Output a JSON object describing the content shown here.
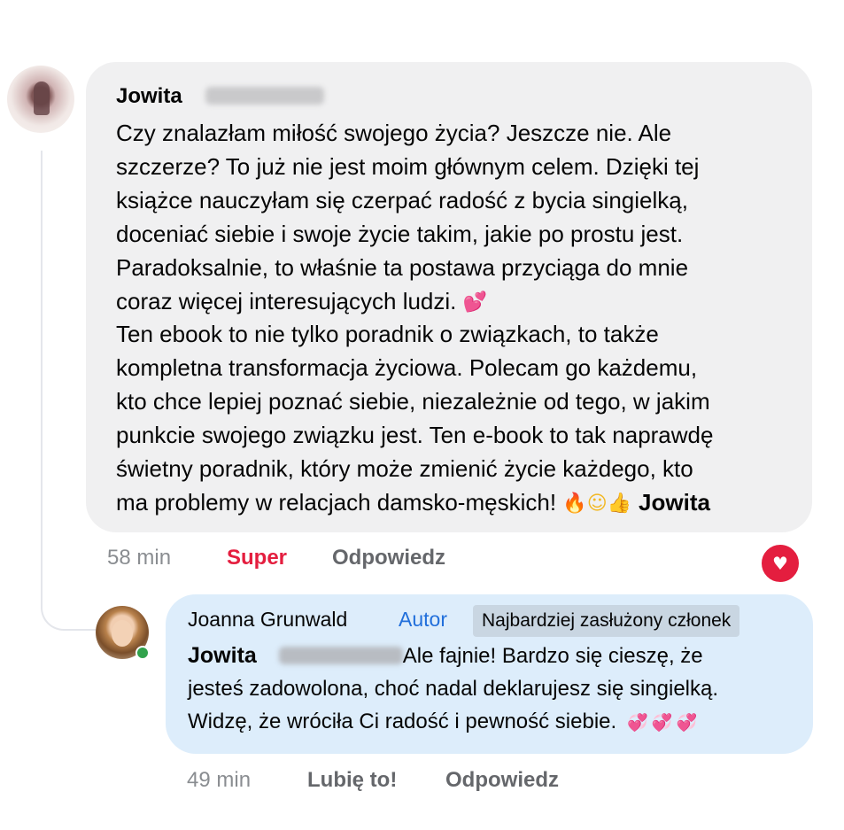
{
  "comment": {
    "author_first_name": "Jowita",
    "avatar_icon": "profile-photo-avatar",
    "lines": [
      "Czy znalazłam miłość swojego życia? Jeszcze nie. Ale",
      "szczerze? To już nie jest moim głównym celem. Dzięki tej",
      "książce nauczyłam się czerpać radość z bycia singielką,",
      "doceniać siebie i swoje życie takim, jakie po prostu jest.",
      "Paradoksalnie, to właśnie ta postawa przyciąga do mnie",
      "coraz więcej interesujących ludzi.",
      "Ten ebook to nie tylko poradnik o związkach, to także",
      "kompletna transformacja życiowa. Polecam go każdemu,",
      "kto chce lepiej poznać siebie, niezależnie od tego, w jakim",
      "punkcie swojego związku jest. Ten e-book to tak naprawdę",
      "świetny poradnik, który może zmienić życie każdego, kto",
      "ma problemy w relacjach damsko-męskich!"
    ],
    "emoji_line6": "💕",
    "emoji_end": [
      "🔥",
      "☺",
      "👍"
    ],
    "signature": "Jowita",
    "time": "58 min",
    "reaction_label": "Super",
    "reply_label": "Odpowiedz",
    "reaction_icon": "heart-reaction-icon",
    "reaction_glyph": "♥",
    "reaction_color": "#e41e3f"
  },
  "reply": {
    "author_name": "Joanna Grunwald",
    "author_badge": "Autor",
    "member_badge": "Najbardziej zasłużony członek",
    "mention": "Jowita",
    "line1_text": "Ale fajnie! Bardzo się cieszę, że",
    "line2": "jesteś zadowolona, choć nadal deklarujesz się singielką.",
    "line3": "Widzę, że wróciła Ci radość i pewność siebie.",
    "hearts": "💞💞💞",
    "time": "49 min",
    "like_label": "Lubię to!",
    "reply_label": "Odpowiedz",
    "online_status_color": "#31a24c"
  },
  "colors": {
    "bubble_gray": "#f0f0f1",
    "bubble_blue": "#ddedfb",
    "link_blue": "#216fdb",
    "super_red": "#e41e3f"
  }
}
